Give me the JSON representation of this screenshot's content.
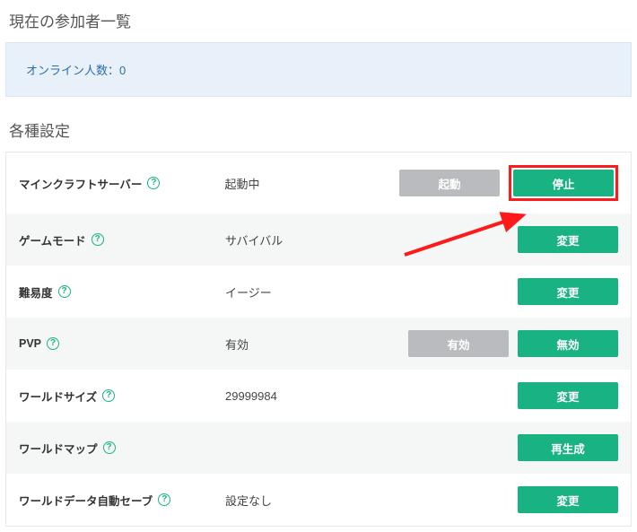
{
  "participants": {
    "title": "現在の参加者一覧",
    "online_text": "オンライン人数：0"
  },
  "settings": {
    "title": "各種設定",
    "rows": [
      {
        "label": "マインクラフトサーバー",
        "value": "起動中",
        "btn_disabled": "起動",
        "btn_primary": "停止"
      },
      {
        "label": "ゲームモード",
        "value": "サバイバル",
        "btn_primary": "変更"
      },
      {
        "label": "難易度",
        "value": "イージー",
        "btn_primary": "変更"
      },
      {
        "label": "PVP",
        "value": "有効",
        "btn_disabled": "有効",
        "btn_primary": "無効"
      },
      {
        "label": "ワールドサイズ",
        "value": "29999984",
        "btn_primary": "変更"
      },
      {
        "label": "ワールドマップ",
        "value": "",
        "btn_primary": "再生成"
      },
      {
        "label": "ワールドデータ自動セーブ",
        "value": "設定なし",
        "btn_primary": "変更"
      }
    ]
  }
}
